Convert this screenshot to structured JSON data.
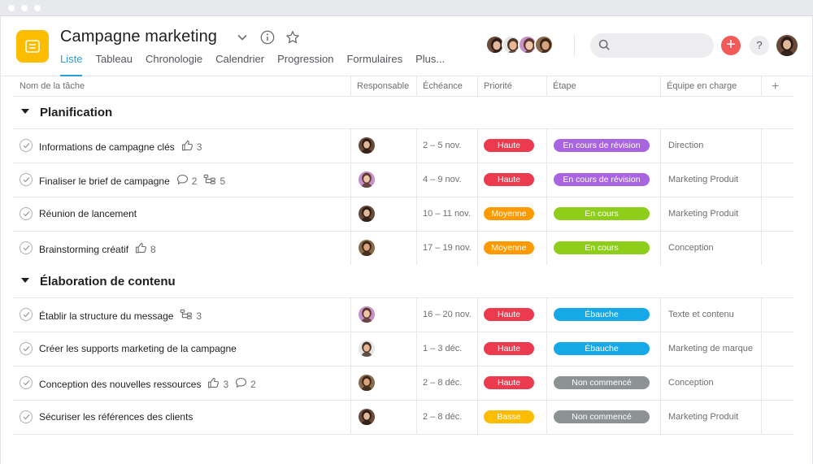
{
  "project": {
    "title": "Campagne marketing",
    "icon": "list-document-icon",
    "accent_color": "#fcbd01"
  },
  "tabs": [
    {
      "label": "Liste",
      "active": true
    },
    {
      "label": "Tableau",
      "active": false
    },
    {
      "label": "Chronologie",
      "active": false
    },
    {
      "label": "Calendrier",
      "active": false
    },
    {
      "label": "Progression",
      "active": false
    },
    {
      "label": "Formulaires",
      "active": false
    },
    {
      "label": "Plus...",
      "active": false
    }
  ],
  "header_actions": {
    "search_placeholder": "",
    "add_icon": "plus-icon",
    "help_label": "?",
    "add_label": "+"
  },
  "columns": [
    "Nom de la tâche",
    "Responsable",
    "Échéance",
    "Priorité",
    "Étape",
    "Équipe en charge",
    "+"
  ],
  "colors": {
    "Haute": "#ec3b4e",
    "Moyenne": "#fd9a00",
    "Basse": "#fcbd01",
    "En cours de révision": "#a964e0",
    "En cours": "#8ece1b",
    "Ébauche": "#16a9e7",
    "Non commencé": "#8d9394"
  },
  "sections": [
    {
      "title": "Planification",
      "tasks": [
        {
          "name": "Informations de campagne clés",
          "likes": "3",
          "comments": "",
          "subtasks": "",
          "assignee": "woman-a",
          "due": "2 – 5 nov.",
          "priority": "Haute",
          "stage": "En cours de révision",
          "team": "Direction"
        },
        {
          "name": "Finaliser le brief de campagne",
          "likes": "",
          "comments": "2",
          "subtasks": "5",
          "assignee": "woman-b",
          "due": "4 – 9 nov.",
          "priority": "Haute",
          "stage": "En cours de révision",
          "team": "Marketing Produit"
        },
        {
          "name": "Réunion de lancement",
          "likes": "",
          "comments": "",
          "subtasks": "",
          "assignee": "woman-a",
          "due": "10 – 11 nov.",
          "priority": "Moyenne",
          "stage": "En cours",
          "team": "Marketing Produit"
        },
        {
          "name": "Brainstorming créatif",
          "likes": "8",
          "comments": "",
          "subtasks": "",
          "assignee": "man-a",
          "due": "17 – 19 nov.",
          "priority": "Moyenne",
          "stage": "En cours",
          "team": "Conception"
        }
      ]
    },
    {
      "title": "Élaboration de contenu",
      "tasks": [
        {
          "name": "Établir la structure du message",
          "likes": "",
          "comments": "",
          "subtasks": "3",
          "assignee": "woman-b",
          "due": "16 – 20 nov.",
          "priority": "Haute",
          "stage": "Ébauche",
          "team": "Texte et contenu"
        },
        {
          "name": "Créer les supports marketing de la campagne",
          "likes": "",
          "comments": "",
          "subtasks": "",
          "assignee": "man-b",
          "due": "1 – 3 déc.",
          "priority": "Haute",
          "stage": "Ébauche",
          "team": "Marketing de marque"
        },
        {
          "name": "Conception des nouvelles ressources",
          "likes": "3",
          "comments": "2",
          "subtasks": "",
          "assignee": "man-a",
          "due": "2 – 8 déc.",
          "priority": "Haute",
          "stage": "Non commencé",
          "team": "Conception"
        },
        {
          "name": "Sécuriser les références des clients",
          "likes": "",
          "comments": "",
          "subtasks": "",
          "assignee": "woman-a",
          "due": "2 – 8 déc.",
          "priority": "Basse",
          "stage": "Non commencé",
          "team": "Marketing Produit"
        }
      ]
    }
  ],
  "avatar_styles": {
    "woman-a": {
      "bg": "#6b4a3a",
      "face": "#e2b89a",
      "hair": "#2b1c16"
    },
    "woman-b": {
      "bg": "#c790c8",
      "face": "#f0c4a8",
      "hair": "#5a3a2e"
    },
    "man-a": {
      "bg": "#8a6a4a",
      "face": "#d9a37e",
      "hair": "#3a2618"
    },
    "man-b": {
      "bg": "#e6e6e6",
      "face": "#e8b596",
      "hair": "#4a3424"
    }
  }
}
